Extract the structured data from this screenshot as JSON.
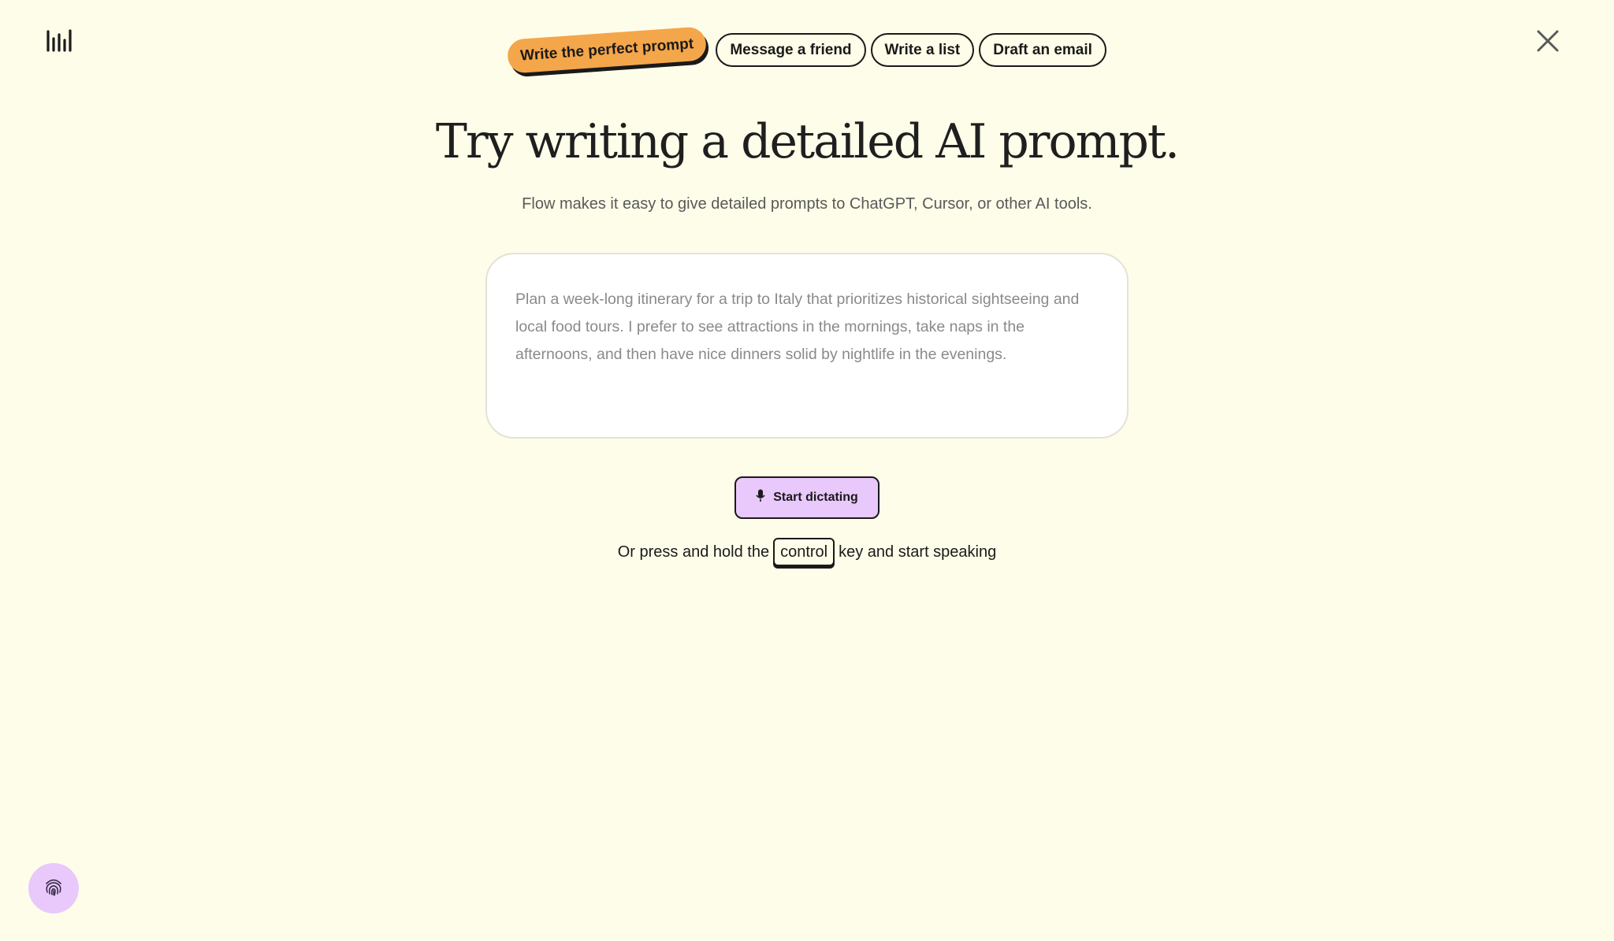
{
  "app": {
    "logo_icon": "waveform-logo-icon",
    "close_icon": "close-icon"
  },
  "tabs": [
    {
      "label": "Write the perfect prompt",
      "active": true
    },
    {
      "label": "Message a friend",
      "active": false
    },
    {
      "label": "Write a list",
      "active": false
    },
    {
      "label": "Draft an email",
      "active": false
    }
  ],
  "main": {
    "title": "Try writing a detailed AI prompt.",
    "subtitle": "Flow makes it easy to give detailed prompts to ChatGPT, Cursor, or other AI tools.",
    "prompt_placeholder": "Plan a week-long itinerary for a trip to Italy that prioritizes historical sightseeing and local food tours. I prefer to see attractions in the mornings, take naps in the afternoons, and then have nice dinners solid by nightlife in the evenings."
  },
  "dictation": {
    "button_label": "Start dictating",
    "button_icon": "microphone-icon",
    "hint_before": "Or press and hold the",
    "key_label": "control",
    "hint_after": "key and start speaking"
  },
  "floating": {
    "icon": "fingerprint-icon"
  },
  "colors": {
    "background": "#fefde9",
    "active_tab": "#f4a64a",
    "accent_purple": "#e9c8fb",
    "text": "#1a1a1a"
  }
}
